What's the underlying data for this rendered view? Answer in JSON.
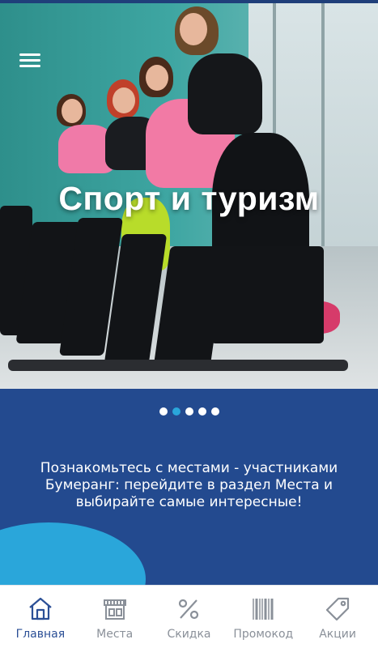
{
  "hero": {
    "title": "Спорт и туризм",
    "slides_total": 5,
    "active_slide": 2
  },
  "info": {
    "text": "Познакомьтесь с местами - участниками Бумеранг: перейдите в раздел Места и выбирайте самые интересные!"
  },
  "nav": {
    "items": [
      {
        "label": "Главная",
        "icon": "home-icon",
        "active": true
      },
      {
        "label": "Места",
        "icon": "store-icon",
        "active": false
      },
      {
        "label": "Скидка",
        "icon": "percent-icon",
        "active": false
      },
      {
        "label": "Промокод",
        "icon": "barcode-icon",
        "active": false
      },
      {
        "label": "Акции",
        "icon": "tag-icon",
        "active": false
      }
    ]
  },
  "colors": {
    "primary": "#234a8f",
    "accent": "#2aa6da",
    "nav_active": "#2b4f96",
    "nav_inactive": "#8a9099"
  }
}
